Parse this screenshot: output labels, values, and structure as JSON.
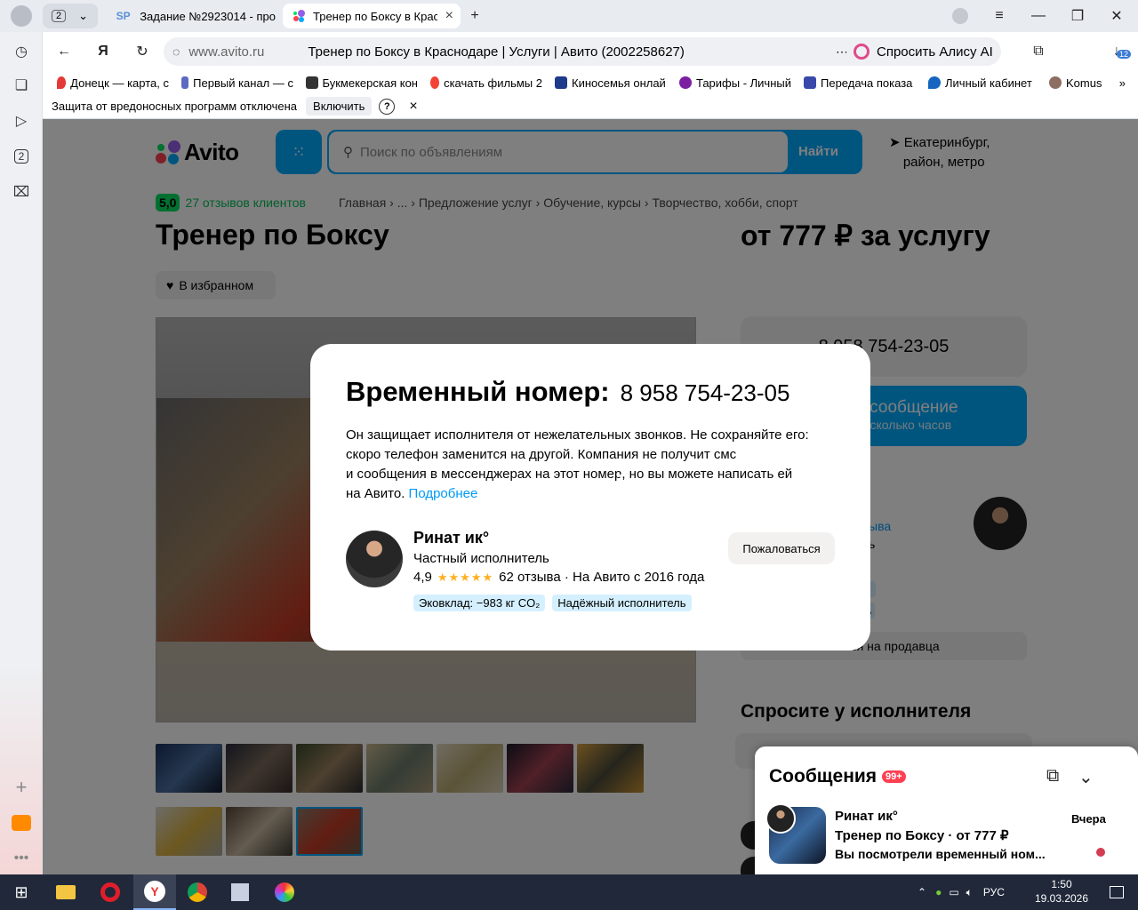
{
  "browser": {
    "tab_count": "2",
    "tabs": [
      {
        "icon": "SP",
        "label": "Задание №2923014 - про"
      },
      {
        "label": "Тренер по Боксу в Крас"
      }
    ],
    "url_host": "www.avito.ru",
    "page_title": "Тренер по Боксу в Краснодаре | Услуги | Авито (2002258627)",
    "alice_label": "Спросить Алису AI",
    "downloads_badge": "12",
    "sidebar_badge": "2",
    "bookmarks": [
      {
        "label": "Донецк — карта, с",
        "color": "#e53935"
      },
      {
        "label": "Первый канал — с",
        "color": "#5c6bc0"
      },
      {
        "label": "Букмекерская кон",
        "color": "#333333"
      },
      {
        "label": "скачать фильмы 2",
        "color": "#f44336"
      },
      {
        "label": "Киносемья онлай",
        "color": "#1e3a8a"
      },
      {
        "label": "Тарифы - Личный",
        "color": "#7b1fa2"
      },
      {
        "label": "Передача показа",
        "color": "#3949ab"
      },
      {
        "label": "Личный кабинет",
        "color": "#1565c0"
      },
      {
        "label": "Komus",
        "color": "#8d6e63"
      }
    ],
    "protection_text": "Защита от вредоносных программ отключена",
    "protection_enable": "Включить",
    "protection_help": "?",
    "protection_close": "×"
  },
  "site": {
    "logo_text": "Avito",
    "search_placeholder": "Поиск по объявлениям",
    "search_button": "Найти",
    "location_line1": "Екатеринбург,",
    "location_line2": "район, метро",
    "rating_value": "5,0",
    "rating_reviews": "27 отзывов клиентов",
    "breadcrumbs": "Главная  ›  ...  ›  Предложение услуг  ›  Обучение, курсы  ›  Творчество, хобби, спорт",
    "title": "Тренер по Боксу",
    "price": "от 777 ₽ за услугу",
    "favorite_label": "В избранном",
    "phone_partial": "8 958 754-23-05",
    "message_btn_partial": "ь сообщение",
    "message_btn_sub_partial": "несколько часов",
    "side_reviews_partial": "ыва",
    "side_text_partial": "ь",
    "side_badge_partial": "ль",
    "report_partial": "ться на продавца",
    "ask_heading": "Спросите у исполнителя"
  },
  "modal": {
    "title": "Временный номер:",
    "number": "8 958 754-23-05",
    "text_line1": "Он защищает исполнителя от нежелательных звонков. Не сохраняйте его:",
    "text_line2": "скоро телефон заменится на другой. Компания не получит смс",
    "text_line3": "и сообщения в мессенджерах на этот номер, но вы можете написать ей",
    "text_line4": "на Авито.",
    "more_link": "Подробнее",
    "seller_name": "Ринат ик°",
    "seller_role": "Частный исполнитель",
    "seller_rating": "4,9",
    "seller_stars": "★★★★★",
    "seller_reviews": "62 отзыва",
    "seller_since": "· На Авито с 2016 года",
    "badge_eco": "Эковклад: −983 кг CO₂",
    "badge_reliable": "Надёжный исполнитель",
    "report_button": "Пожаловаться",
    "close": "×"
  },
  "messages": {
    "header": "Сообщения",
    "count": "99+",
    "chat_name": "Ринат ик°",
    "chat_subject": "Тренер по Боксу · от 777 ₽",
    "chat_last": "Вы посмотрели временный ном...",
    "chat_time": "Вчера"
  },
  "taskbar": {
    "lang": "РУС",
    "time": "1:50",
    "date": "19.03.2026"
  },
  "colors": {
    "avito_blue": "#00aaff",
    "rating_green": "#04e061",
    "link_blue": "#0099f7",
    "unread_red": "#d43c52"
  }
}
